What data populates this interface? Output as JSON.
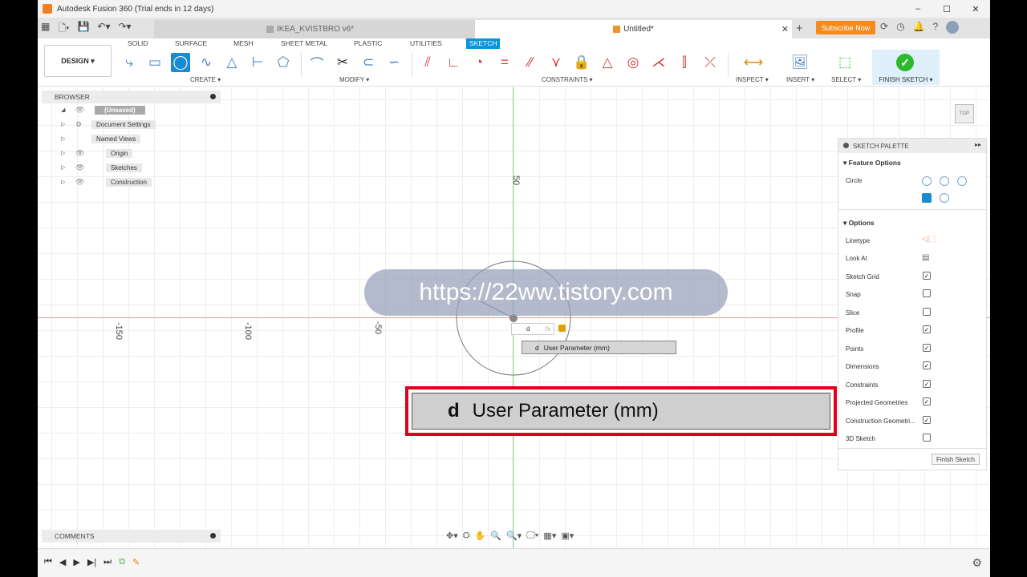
{
  "window": {
    "title": "Autodesk Fusion 360 (Trial ends in 12 days)"
  },
  "tabs": [
    {
      "label": "IKEA_KVISTBRO v6*"
    },
    {
      "label": "Untitled*"
    }
  ],
  "subscribe_label": "Subscribe Now",
  "ribbon": {
    "tabs": [
      "SOLID",
      "SURFACE",
      "MESH",
      "SHEET METAL",
      "PLASTIC",
      "UTILITIES",
      "SKETCH"
    ],
    "active_tab": "SKETCH",
    "workspace": "DESIGN ▾",
    "groups": {
      "create": "CREATE ▾",
      "modify": "MODIFY ▾",
      "constraints": "CONSTRAINTS ▾",
      "inspect": "INSPECT ▾",
      "insert": "INSERT ▾",
      "select": "SELECT ▾",
      "finish": "FINISH SKETCH ▾"
    }
  },
  "browser": {
    "title": "BROWSER",
    "items": [
      {
        "label": "(Unsaved)"
      },
      {
        "label": "Document Settings"
      },
      {
        "label": "Named Views"
      },
      {
        "label": "Origin"
      },
      {
        "label": "Sketches"
      },
      {
        "label": "Construction"
      }
    ]
  },
  "comments_label": "COMMENTS",
  "ruler": {
    "top": "50",
    "left": [
      "-150",
      "-100",
      "-50"
    ]
  },
  "viewcube_label": "TOP",
  "watermark": "https://22ww.tistory.com",
  "dimension_input": {
    "value": "d",
    "fx": "fx"
  },
  "autocomplete": {
    "key": "d",
    "label": "User Parameter (mm)"
  },
  "zoom": {
    "key": "d",
    "label": "User Parameter (mm)"
  },
  "palette": {
    "title": "SKETCH PALETTE",
    "feature_options": "Feature Options",
    "circle_label": "Circle",
    "options_title": "Options",
    "options": [
      {
        "label": "Linetype",
        "checked": null
      },
      {
        "label": "Look At",
        "checked": null
      },
      {
        "label": "Sketch Grid",
        "checked": true
      },
      {
        "label": "Snap",
        "checked": false
      },
      {
        "label": "Slice",
        "checked": false
      },
      {
        "label": "Profile",
        "checked": true
      },
      {
        "label": "Points",
        "checked": true
      },
      {
        "label": "Dimensions",
        "checked": true
      },
      {
        "label": "Constraints",
        "checked": true
      },
      {
        "label": "Projected Geometries",
        "checked": true
      },
      {
        "label": "Construction Geometri...",
        "checked": true
      },
      {
        "label": "3D Sketch",
        "checked": false
      }
    ],
    "finish_button": "Finish Sketch"
  },
  "colors": {
    "accent": "#0696d7",
    "highlight": "#e0001b",
    "subscribe": "#f58b1f",
    "finish_check": "#2eb82e"
  }
}
